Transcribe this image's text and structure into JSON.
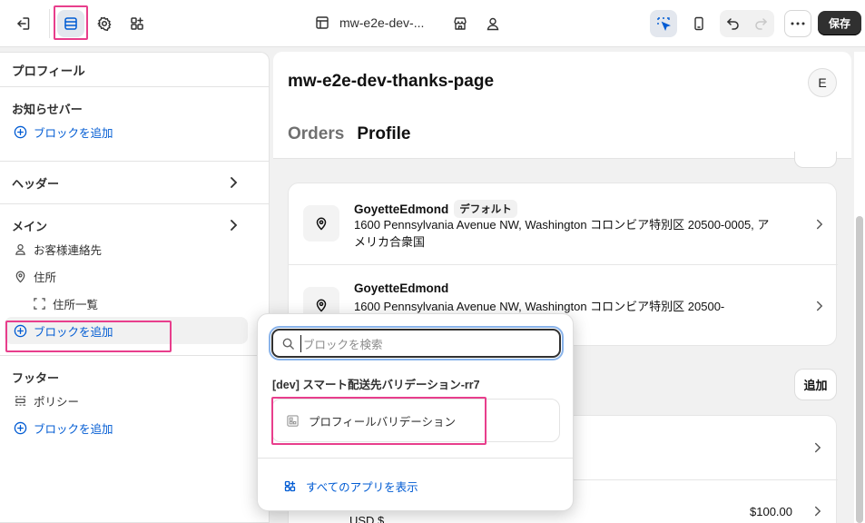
{
  "topbar": {
    "title": "mw-e2e-dev-...",
    "save_label": "保存",
    "icons": [
      "exit-icon",
      "sections-icon",
      "settings-icon",
      "apps-icon",
      "page-icon",
      "store-icon",
      "account-icon",
      "inspector-icon",
      "mobile-icon",
      "undo-icon",
      "redo-icon",
      "more-icon"
    ]
  },
  "sidebar": {
    "header": "プロフィール",
    "announcement": {
      "title": "お知らせバー",
      "add_block": "ブロックを追加"
    },
    "header_section": {
      "title": "ヘッダー"
    },
    "main": {
      "title": "メイン",
      "items": [
        {
          "label": "お客様連絡先",
          "icon": "person-icon"
        },
        {
          "label": "住所",
          "icon": "location-icon"
        },
        {
          "label": "住所一覧",
          "icon": "dashed-frame-icon"
        }
      ],
      "add_block": "ブロックを追加"
    },
    "footer": {
      "title": "フッター",
      "items": [
        {
          "label": "ポリシー",
          "icon": "policy-icon"
        }
      ],
      "add_block": "ブロックを追加"
    }
  },
  "preview": {
    "page_title": "mw-e2e-dev-thanks-page",
    "avatar_initial": "E",
    "tabs": [
      "Orders",
      "Profile"
    ],
    "addresses": [
      {
        "name": "GoyetteEdmond",
        "badge": "デフォルト",
        "line": "1600 Pennsylvania Avenue NW, Washington コロンビア特別区 20500-0005, アメリカ合衆国"
      },
      {
        "name": "GoyetteEdmond",
        "badge": "",
        "line": "1600 Pennsylvania Avenue NW, Washington コロンビア特別区 20500-"
      }
    ],
    "add_label": "追加",
    "price": "$100.00",
    "currency": "USD $"
  },
  "popup": {
    "search_placeholder": "ブロックを検索",
    "group_title": "[dev] スマート配送先バリデーション-rr7",
    "item_label": "プロフィールバリデーション",
    "show_all": "すべてのアプリを表示"
  },
  "colors": {
    "link": "#005bd3",
    "highlight": "#e83e8c",
    "save_bg": "#303030"
  }
}
